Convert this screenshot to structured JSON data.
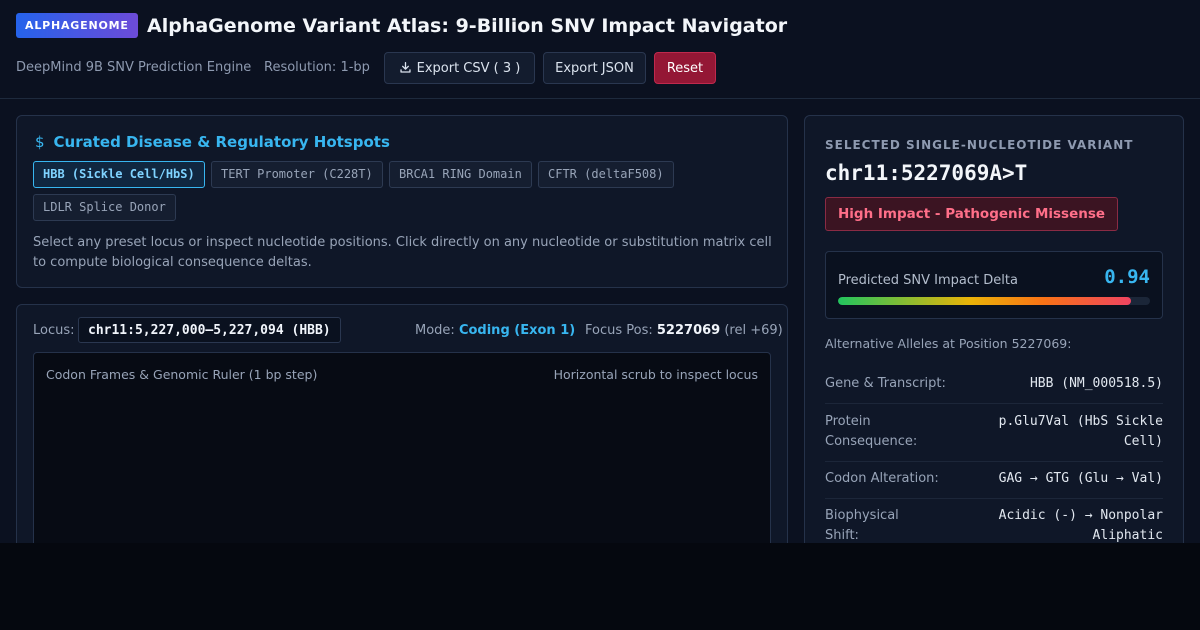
{
  "header": {
    "badge": "ALPHAGENOME",
    "title": "AlphaGenome Variant Atlas: 9-Billion SNV Impact Navigator",
    "engine": "DeepMind 9B SNV Prediction Engine",
    "resolution": "Resolution: 1-bp",
    "export_csv_label": "Export CSV (",
    "export_csv_count": "3",
    "export_csv_close": ")",
    "export_json_label": "Export JSON",
    "reset_label": "Reset"
  },
  "hotspots": {
    "icon": "dollar-icon",
    "title": "Curated Disease & Regulatory Hotspots",
    "chips": [
      {
        "label": "HBB (Sickle Cell/HbS)",
        "active": true
      },
      {
        "label": "TERT Promoter (C228T)",
        "active": false
      },
      {
        "label": "BRCA1 RING Domain",
        "active": false
      },
      {
        "label": "CFTR (deltaF508)",
        "active": false
      },
      {
        "label": "LDLR Splice Donor",
        "active": false
      }
    ],
    "help": "Select any preset locus or inspect nucleotide positions. Click directly on any nucleotide or substitution matrix cell to compute biological consequence deltas."
  },
  "locus": {
    "label": "Locus:",
    "value": "chr11:5,227,000–5,227,094 (HBB)",
    "mode_label": "Mode:",
    "mode_value": "Coding (Exon 1)",
    "focus_label": "Focus Pos:",
    "focus_value": "5227069",
    "focus_rel": "(rel +69)",
    "canvas_left": "Codon Frames & Genomic Ruler (1 bp step)",
    "canvas_right": "Horizontal scrub to inspect locus"
  },
  "variant": {
    "section_label": "SELECTED SINGLE-NUCLEOTIDE VARIANT",
    "id": "chr11:5227069A>T",
    "impact_badge": "High Impact - Pathogenic Missense",
    "delta_label": "Predicted SNV Impact Delta",
    "delta_value": "0.94",
    "delta_fraction": 0.94,
    "alt_alleles": "Alternative Alleles at Position 5227069:",
    "details": [
      {
        "key": "Gene & Transcript:",
        "value": "HBB (NM_000518.5)"
      },
      {
        "key": "Protein Consequence:",
        "value": "p.Glu7Val (HbS Sickle Cell)"
      },
      {
        "key": "Codon Alteration:",
        "value": "GAG → GTG (Glu → Val)"
      },
      {
        "key": "Biophysical Shift:",
        "value": "Acidic (-) → Nonpolar Aliphatic"
      }
    ]
  },
  "colors": {
    "accent": "#38b6f0",
    "danger": "#941735",
    "impact_text": "#ff6f89"
  }
}
